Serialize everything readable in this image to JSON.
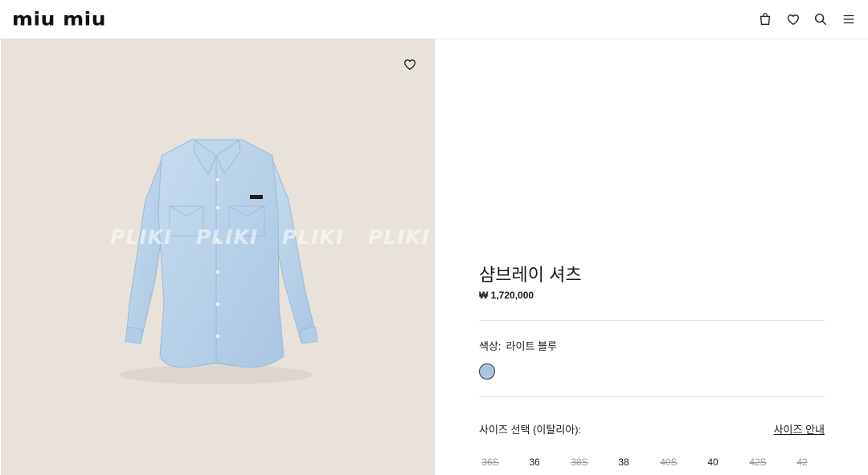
{
  "header": {
    "logo": "miu miu",
    "icons": [
      "shopping-bag-icon",
      "heart-icon",
      "search-icon",
      "menu-icon"
    ]
  },
  "image": {
    "description_icon": "heart-icon",
    "watermark": "PLIKI PLIKI PLIKI PLIKI PLI",
    "background": "#e8e2da",
    "shirt_color": "#b7d1ea"
  },
  "product": {
    "title": "샴브레이 셔츠",
    "price": "₩ 1,720,000",
    "color_label": "색상:",
    "color_value": "라이트 블루",
    "swatch_color": "#a9c5e6",
    "size_label": "사이즈 선택 (이탈리아):",
    "size_guide": "사이즈 안내",
    "sizes": [
      {
        "label": "36S",
        "available": false
      },
      {
        "label": "36",
        "available": true
      },
      {
        "label": "38S",
        "available": false
      },
      {
        "label": "38",
        "available": true
      },
      {
        "label": "40S",
        "available": false
      },
      {
        "label": "40",
        "available": true
      },
      {
        "label": "42S",
        "available": false
      },
      {
        "label": "42",
        "available": false
      }
    ]
  }
}
